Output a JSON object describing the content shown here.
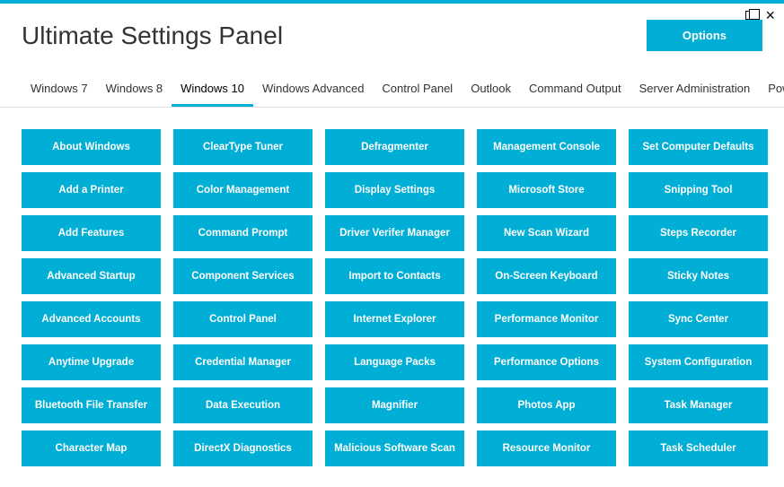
{
  "colors": {
    "accent": "#00aed6"
  },
  "app": {
    "title": "Ultimate Settings Panel"
  },
  "header": {
    "options_label": "Options"
  },
  "tabs": [
    {
      "label": "Windows 7",
      "active": false
    },
    {
      "label": "Windows 8",
      "active": false
    },
    {
      "label": "Windows 10",
      "active": true
    },
    {
      "label": "Windows Advanced",
      "active": false
    },
    {
      "label": "Control Panel",
      "active": false
    },
    {
      "label": "Outlook",
      "active": false
    },
    {
      "label": "Command Output",
      "active": false
    },
    {
      "label": "Server Administration",
      "active": false
    },
    {
      "label": "Powershell",
      "active": false
    }
  ],
  "columns": [
    [
      "About Windows",
      "Add a Printer",
      "Add Features",
      "Advanced Startup",
      "Advanced Accounts",
      "Anytime Upgrade",
      "Bluetooth File Transfer",
      "Character Map"
    ],
    [
      "ClearType Tuner",
      "Color Management",
      "Command Prompt",
      "Component Services",
      "Control Panel",
      "Credential Manager",
      "Data Execution",
      "DirectX Diagnostics"
    ],
    [
      "Defragmenter",
      "Display Settings",
      "Driver Verifer Manager",
      "Import to Contacts",
      "Internet Explorer",
      "Language Packs",
      "Magnifier",
      "Malicious Software Scan"
    ],
    [
      "Management Console",
      "Microsoft Store",
      "New Scan Wizard",
      "On-Screen Keyboard",
      "Performance Monitor",
      "Performance Options",
      "Photos App",
      "Resource Monitor"
    ],
    [
      "Set Computer Defaults",
      "Snipping Tool",
      "Steps Recorder",
      "Sticky Notes",
      "Sync Center",
      "System Configuration",
      "Task Manager",
      "Task Scheduler"
    ]
  ]
}
